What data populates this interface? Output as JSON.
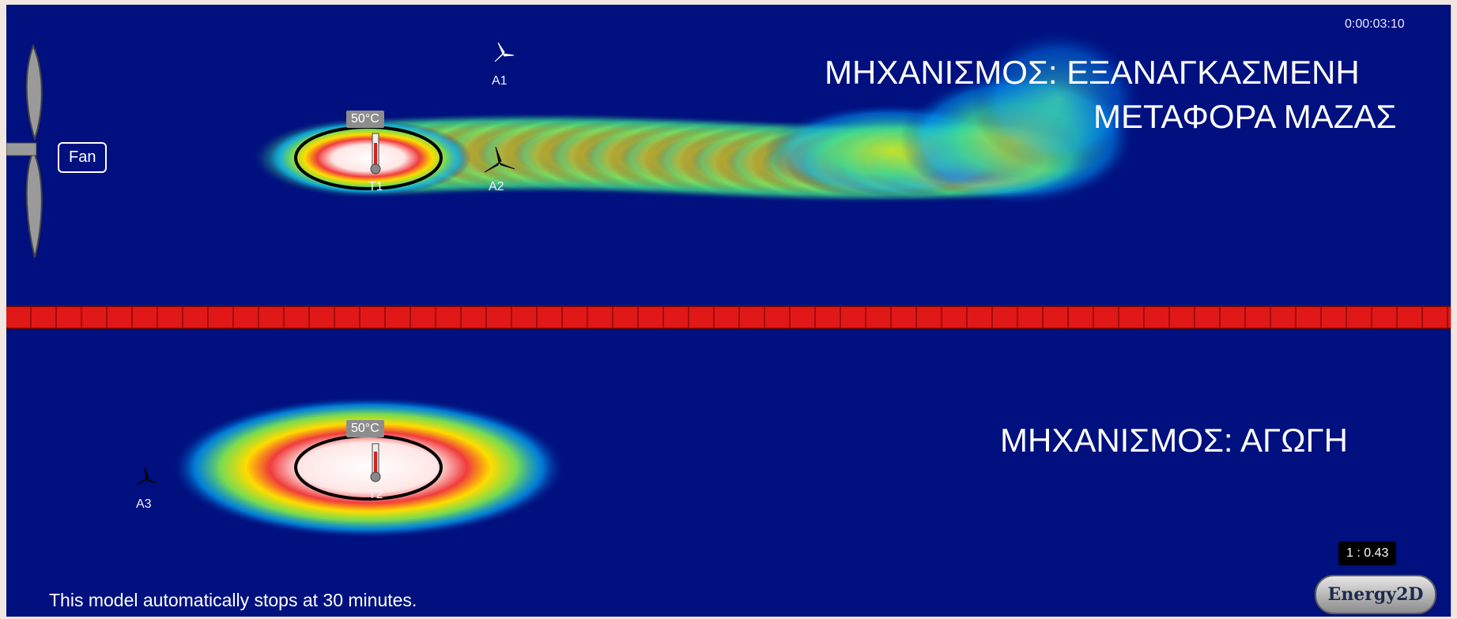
{
  "app": {
    "elapsed_time": "0:00:03:10",
    "speed_ratio": "1 : 0.43",
    "footer_note": "This model automatically stops at 30 minutes.",
    "logo_text": "Energy2D",
    "fan_label": "Fan"
  },
  "top_scene": {
    "title_line1": "ΜΗΧΑΝΙΣΜΟΣ: ΕΞΑΝΑΓΚΑΣΜΕΝΗ",
    "title_line2": "ΜΕΤΑΦΟΡΑ ΜΑΖΑΣ",
    "temp_label": "50°C",
    "sensor_label": "T1",
    "anemometer_a1": "A1",
    "anemometer_a2": "A2"
  },
  "bottom_scene": {
    "title": "ΜΗΧΑΝΙΣΜΟΣ: ΑΓΩΓΗ",
    "temp_label": "50°C",
    "sensor_label": "T2",
    "anemometer_a3": "A3"
  },
  "colors": {
    "background": "#00107f",
    "wall": "#e01818",
    "hot": "#ffffff"
  },
  "icons": [
    "fan-blade-icon",
    "thermometer-icon",
    "anemometer-icon",
    "energy2d-logo"
  ]
}
